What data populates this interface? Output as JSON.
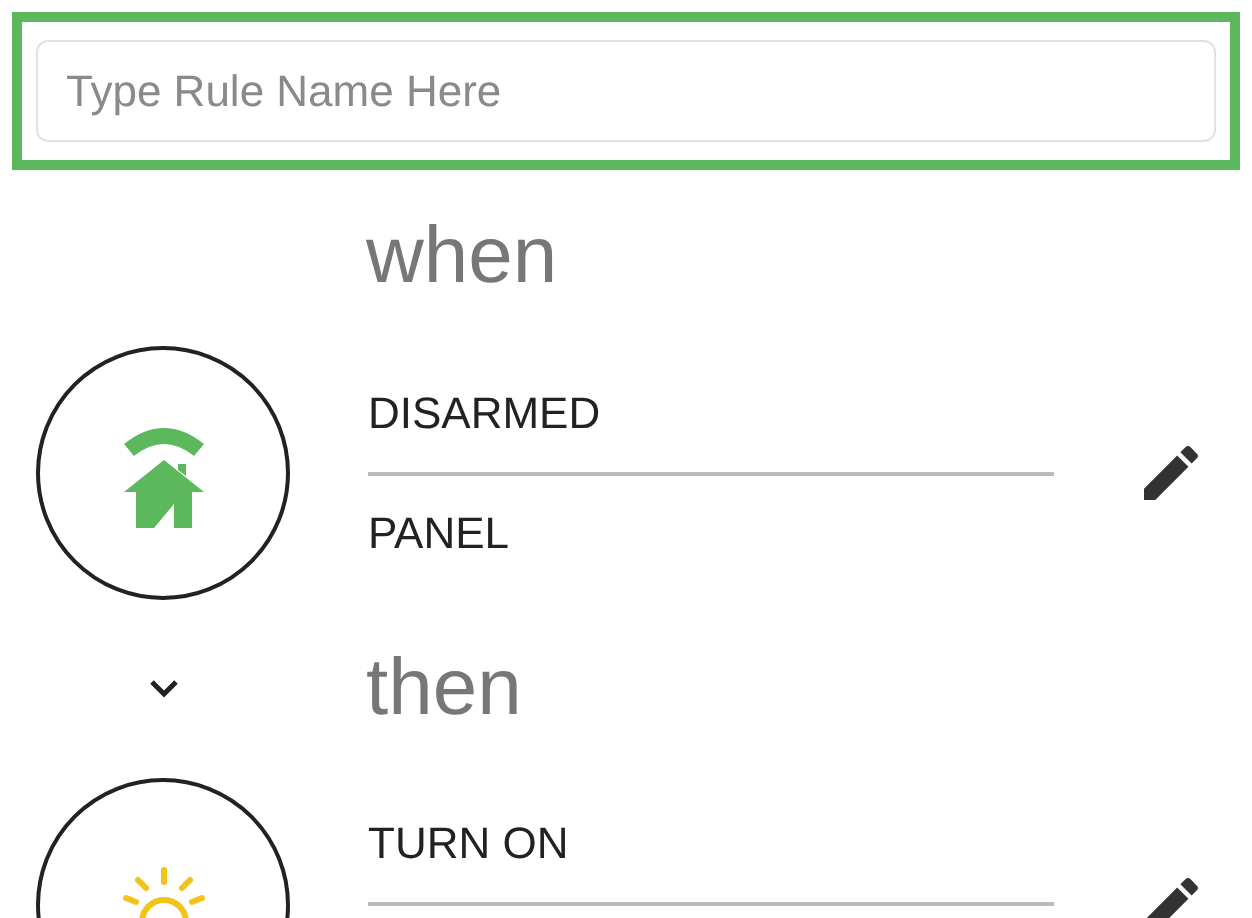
{
  "rule_name": {
    "placeholder": "Type Rule Name Here"
  },
  "sections": [
    {
      "heading": "when",
      "rule": {
        "kind": "panel",
        "lines": [
          "DISARMED",
          "PANEL"
        ]
      }
    },
    {
      "heading": "then",
      "rule": {
        "kind": "light",
        "lines": [
          "TURN ON"
        ]
      }
    }
  ]
}
